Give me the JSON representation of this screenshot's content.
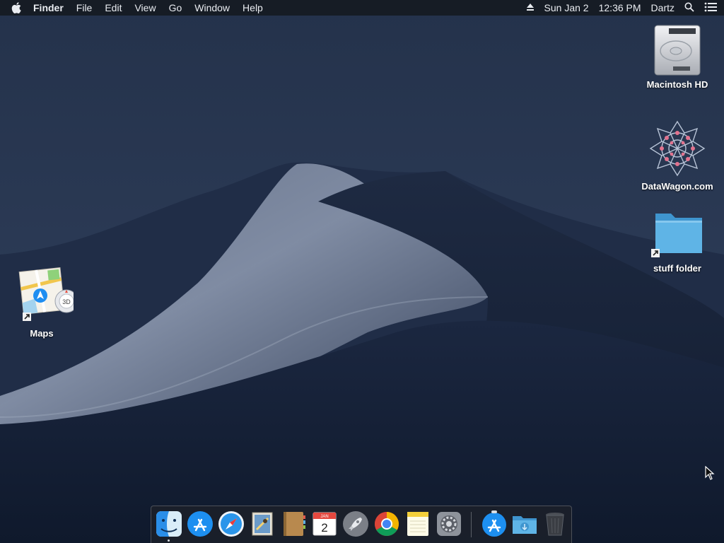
{
  "menubar": {
    "app_name": "Finder",
    "menus": [
      "File",
      "Edit",
      "View",
      "Go",
      "Window",
      "Help"
    ],
    "date": "Sun Jan 2",
    "time": "12:36 PM",
    "user": "Dartz",
    "icons": [
      "apple-logo-icon",
      "eject-icon",
      "spotlight-search-icon",
      "notification-center-icon"
    ]
  },
  "desktop": {
    "icons": [
      {
        "label": "Macintosh HD",
        "icon": "hard-drive-icon"
      },
      {
        "label": "DataWagon.com",
        "icon": "datawagon-logo-icon"
      },
      {
        "label": "stuff folder",
        "icon": "folder-alias-icon"
      },
      {
        "label": "Maps",
        "icon": "maps-alias-icon",
        "badge": "3D"
      }
    ]
  },
  "dock": {
    "apps": [
      {
        "name": "finder",
        "icon": "finder-icon",
        "running": true
      },
      {
        "name": "app-store",
        "icon": "app-store-icon"
      },
      {
        "name": "safari",
        "icon": "safari-icon"
      },
      {
        "name": "mail",
        "icon": "mail-icon"
      },
      {
        "name": "contacts",
        "icon": "contacts-icon"
      },
      {
        "name": "calendar",
        "icon": "calendar-icon",
        "month": "JAN",
        "day": "2"
      },
      {
        "name": "launchpad",
        "icon": "launchpad-icon"
      },
      {
        "name": "chrome",
        "icon": "chrome-icon"
      },
      {
        "name": "notes",
        "icon": "notes-icon"
      },
      {
        "name": "system-preferences",
        "icon": "system-preferences-icon"
      },
      {
        "name": "app-store-download",
        "icon": "app-store-icon"
      },
      {
        "name": "downloads",
        "icon": "downloads-folder-icon"
      },
      {
        "name": "trash",
        "icon": "trash-icon"
      }
    ]
  },
  "colors": {
    "menubar_bg": "#161a22",
    "folder_blue": "#5fb4e6",
    "accent_blue": "#1f8ef1",
    "dune_highlight": "#8a96ad"
  }
}
